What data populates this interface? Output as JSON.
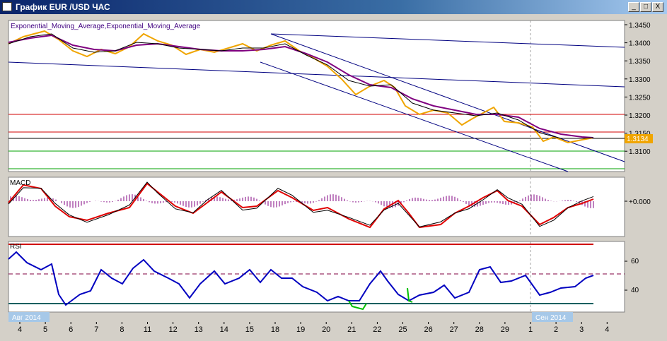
{
  "window": {
    "title": "График EUR /USD ЧАС",
    "buttons": {
      "minimize": "_",
      "maximize": "□",
      "close": "X"
    }
  },
  "colors": {
    "panel_bg": "#ffffff",
    "price": "#f0a500",
    "ema_fast": "#000000",
    "ema_slow": "#800080",
    "channel": "#000080",
    "red_level": "#d00000",
    "green_level": "#00a000",
    "macd_line": "#000000",
    "macd_signal": "#e00000",
    "macd_hist": "#800080",
    "rsi_line": "#0000c0",
    "rsi_highlight": "#00c000",
    "price_tag": "#f0a500"
  },
  "main_panel": {
    "indicator_label": "Exponential_Moving_Average,Exponential_Moving_Average",
    "price_ticks": [
      "1.3450",
      "1.3400",
      "1.3350",
      "1.3300",
      "1.3250",
      "1.3200",
      "1.3150",
      "1.3100"
    ],
    "current_price": "1.3134"
  },
  "macd_panel": {
    "label": "MACD",
    "ticks": [
      "+0.000"
    ]
  },
  "rsi_panel": {
    "label": "RSI",
    "ticks": [
      "60",
      "40"
    ]
  },
  "date_axis": {
    "month_start": "Авг 2014",
    "month_next": "Сен 2014",
    "days": [
      "4",
      "5",
      "6",
      "7",
      "8",
      "11",
      "12",
      "13",
      "14",
      "15",
      "18",
      "19",
      "20",
      "21",
      "22",
      "25",
      "26",
      "27",
      "28",
      "29",
      "1",
      "2",
      "3",
      "4"
    ]
  }
}
